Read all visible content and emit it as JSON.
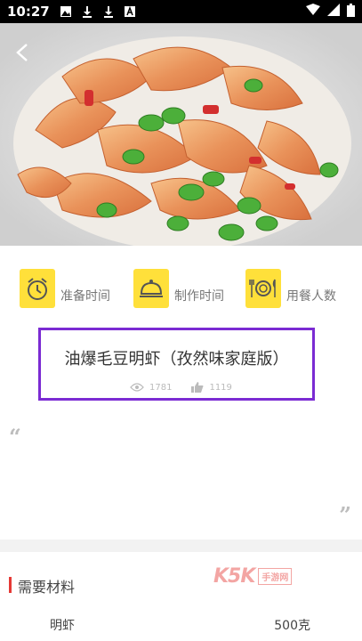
{
  "status_bar": {
    "time": "10:27",
    "icons": [
      "gallery-icon",
      "download-icon",
      "download-icon",
      "text-icon"
    ],
    "right_icons": [
      "wifi-icon",
      "signal-icon",
      "battery-icon"
    ]
  },
  "hero": {
    "image_description": "stir-fried shrimp with edamame",
    "back_icon": "chevron-left-icon"
  },
  "info": {
    "prep_time_label": "准备时间",
    "cook_time_label": "制作时间",
    "servings_label": "用餐人数",
    "icon_color": "#ffe03a"
  },
  "recipe": {
    "title": "油爆毛豆明虾（孜然味家庭版）",
    "views": "1781",
    "likes": "1119"
  },
  "quotes": {
    "open": "“",
    "close": "”"
  },
  "ingredients": {
    "section_title": "需要材料",
    "items": [
      {
        "name": "明虾",
        "amount": "500克"
      }
    ]
  },
  "watermark": {
    "brand": "K5K",
    "sub": "手游网"
  },
  "colors": {
    "accent_red": "#e53935",
    "highlight_purple": "#7b2bd3",
    "icon_yellow": "#ffe03a"
  }
}
